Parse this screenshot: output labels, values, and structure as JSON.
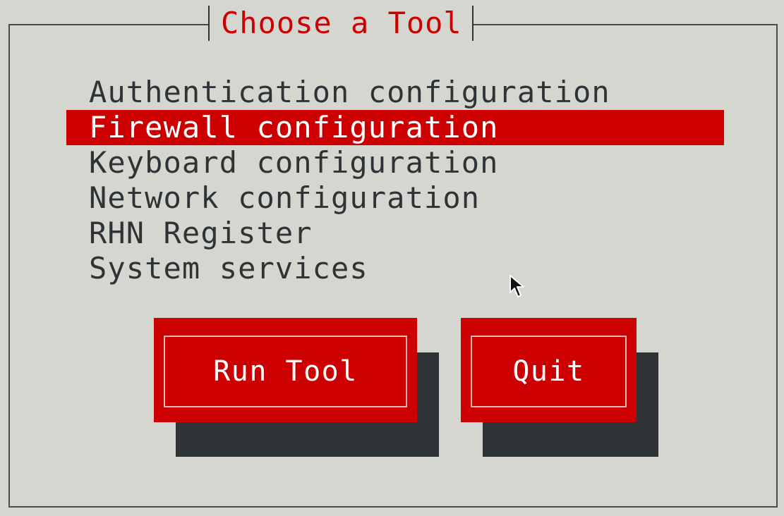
{
  "dialog": {
    "title": "Choose a Tool"
  },
  "menu": {
    "items": [
      {
        "label": "Authentication configuration",
        "selected": false
      },
      {
        "label": "Firewall configuration",
        "selected": true
      },
      {
        "label": "Keyboard configuration",
        "selected": false
      },
      {
        "label": "Network configuration",
        "selected": false
      },
      {
        "label": "RHN Register",
        "selected": false
      },
      {
        "label": "System services",
        "selected": false
      }
    ]
  },
  "buttons": {
    "run_tool_label": "Run Tool",
    "quit_label": "Quit"
  },
  "colors": {
    "background": "#d6d6d0",
    "accent": "#cc0000",
    "shadow": "#2e3436",
    "text": "#2e3436"
  },
  "icons": {
    "pointer": "mouse-pointer-icon"
  }
}
